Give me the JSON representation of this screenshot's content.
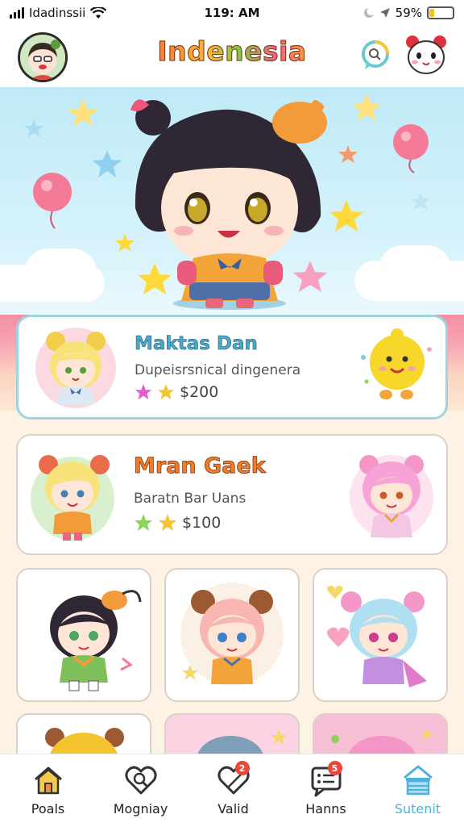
{
  "status_bar": {
    "carrier": "Idadinssii",
    "time": "119: AM",
    "battery": "59%",
    "battery_level": 0.2
  },
  "header": {
    "title": "Indenesia",
    "avatar_icon": "avatar-icon",
    "chat_icon": "chat-bubble-icon",
    "panda_icon": "panda-icon"
  },
  "featured": [
    {
      "name": "Maktas Dan",
      "subtitle": "Dupeisrsnical dingenera",
      "price": "$200",
      "name_color": "#4aa9c9"
    },
    {
      "name": "Mran Gaek",
      "subtitle": "Baratn Bar Uans",
      "price": "$100",
      "name_color": "#f07c2a"
    }
  ],
  "nav": {
    "items": [
      {
        "label": "Poals",
        "icon": "home-icon"
      },
      {
        "label": "Mogniay",
        "icon": "heart-search-icon"
      },
      {
        "label": "Valid",
        "icon": "heart-icon",
        "badge": "2"
      },
      {
        "label": "Hanns",
        "icon": "chat-list-icon",
        "badge": "5"
      },
      {
        "label": "Sutenit",
        "icon": "store-icon"
      }
    ],
    "active_index": 4,
    "active_color": "#4fb1d9"
  },
  "colors": {
    "hero_sky": "#bfeaf7",
    "band_pink": "#f58fa6",
    "page_cream": "#fdf2e4"
  }
}
